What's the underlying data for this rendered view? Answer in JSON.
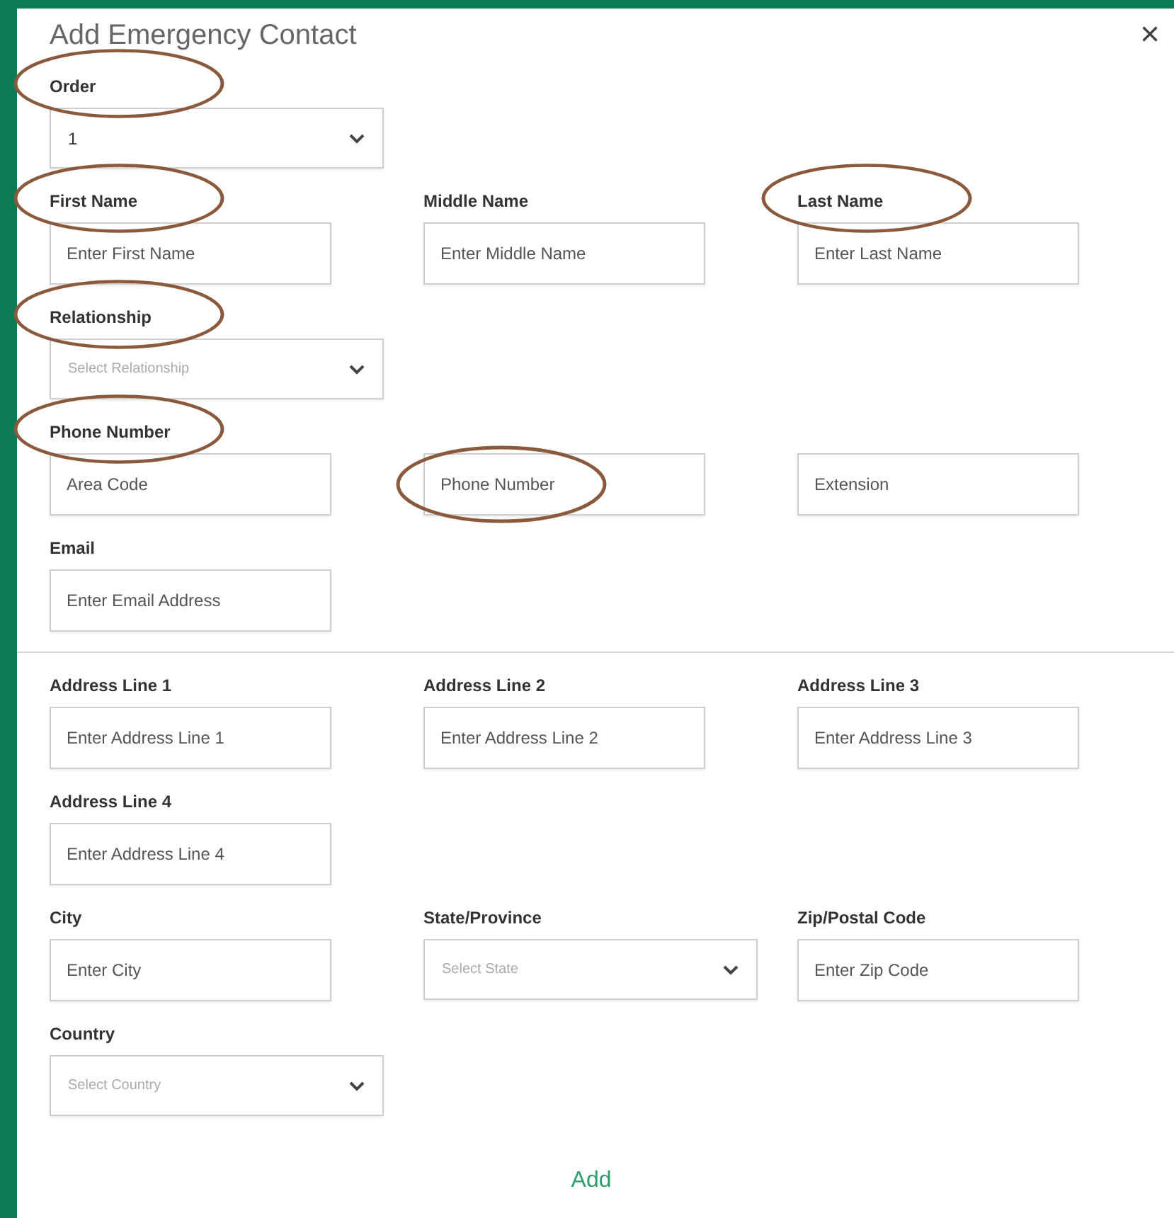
{
  "dialog": {
    "title": "Add Emergency Contact",
    "close": "×"
  },
  "sections": [
    {
      "rows": [
        [
          {
            "kind": "select",
            "label": "Order",
            "value": "1",
            "circled": true
          }
        ],
        [
          {
            "kind": "input",
            "label": "First Name",
            "placeholder": "Enter First Name",
            "circled": true
          },
          {
            "kind": "input",
            "label": "Middle Name",
            "placeholder": "Enter Middle Name",
            "circled": false
          },
          {
            "kind": "input",
            "label": "Last Name",
            "placeholder": "Enter Last Name",
            "circled": true
          }
        ],
        [
          {
            "kind": "select",
            "label": "Relationship",
            "placeholder": "Select Relationship",
            "circled": true
          }
        ],
        [
          {
            "kind": "input",
            "label": "Phone Number",
            "placeholder": "Area Code",
            "circled": true
          },
          {
            "kind": "input",
            "placeholder": "Phone Number",
            "circled": true
          },
          {
            "kind": "input",
            "placeholder": "Extension",
            "circled": false
          }
        ],
        [
          {
            "kind": "input",
            "label": "Email",
            "placeholder": "Enter Email Address",
            "circled": false
          }
        ]
      ]
    },
    {
      "rows": [
        [
          {
            "kind": "input",
            "label": "Address Line 1",
            "placeholder": "Enter Address Line 1",
            "circled": false
          },
          {
            "kind": "input",
            "label": "Address Line 2",
            "placeholder": "Enter Address Line 2",
            "circled": false
          },
          {
            "kind": "input",
            "label": "Address Line 3",
            "placeholder": "Enter Address Line 3",
            "circled": false
          }
        ],
        [
          {
            "kind": "input",
            "label": "Address Line 4",
            "placeholder": "Enter Address Line 4",
            "circled": false
          }
        ],
        [
          {
            "kind": "input",
            "label": "City",
            "placeholder": "Enter City",
            "circled": false
          },
          {
            "kind": "select",
            "label": "State/Province",
            "placeholder": "Select State",
            "circled": false
          },
          {
            "kind": "input",
            "label": "Zip/Postal Code",
            "placeholder": "Enter Zip Code",
            "circled": false
          }
        ],
        [
          {
            "kind": "select",
            "label": "Country",
            "placeholder": "Select Country",
            "circled": false
          }
        ]
      ]
    }
  ],
  "add_button": "Add"
}
